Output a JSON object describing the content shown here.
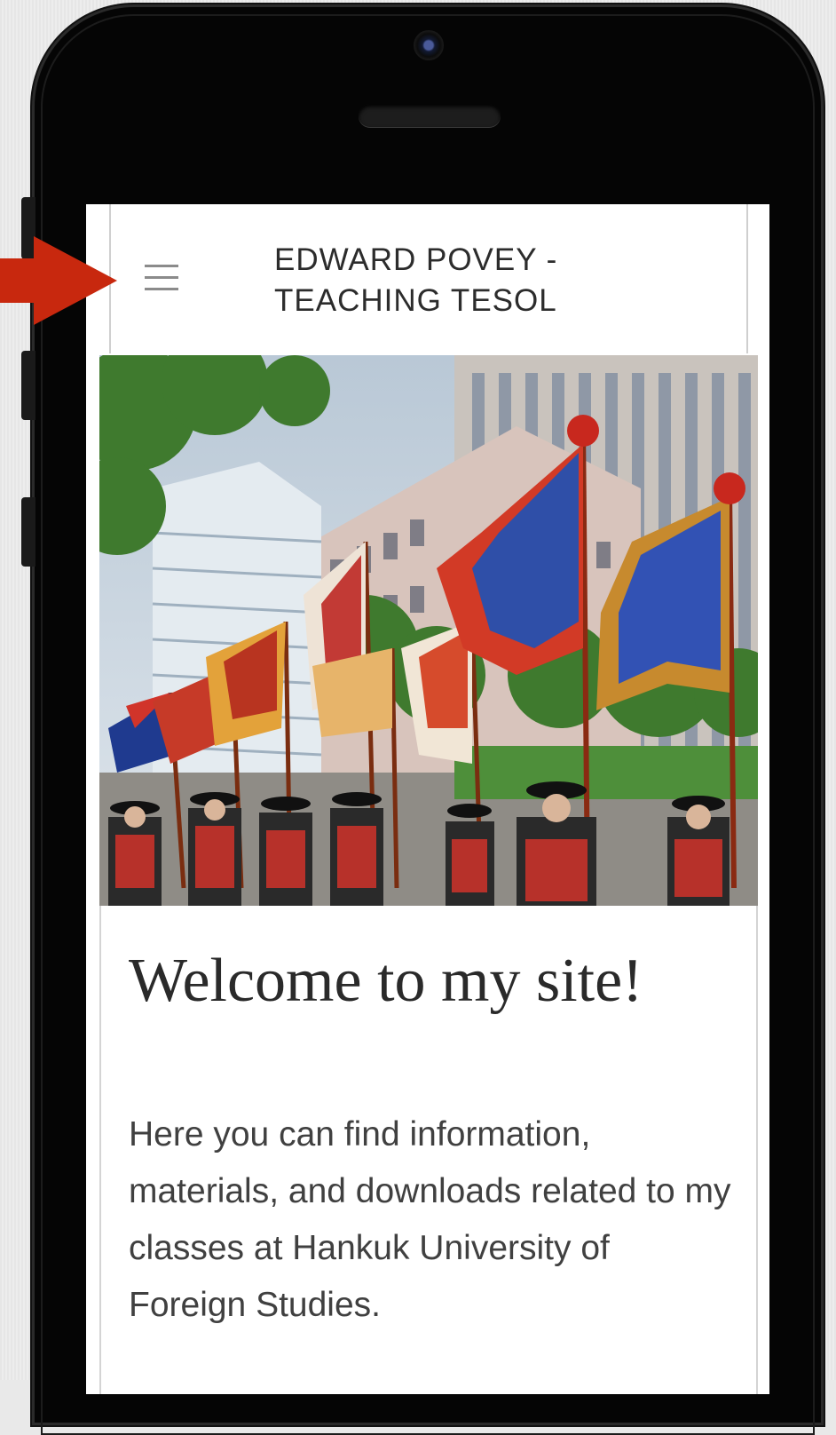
{
  "site": {
    "title": "EDWARD POVEY -\nTEACHING TESOL"
  },
  "hero": {
    "alt": "Royal guard parade with colorful flags in front of city buildings"
  },
  "content": {
    "heading": "Welcome to my site!",
    "intro": "Here you can find information, materials, and downloads related to my classes at Hankuk University of Foreign Studies."
  },
  "icons": {
    "menu": "hamburger-menu-icon",
    "pointer": "red-arrow-icon"
  },
  "colors": {
    "arrow": "#c8280e",
    "phone": "#050505"
  }
}
